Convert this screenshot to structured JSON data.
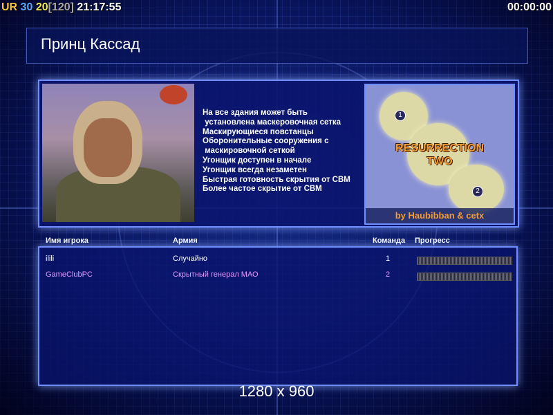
{
  "hud": {
    "ur": "UR",
    "fps": "30",
    "frame": "20",
    "frame_bracket": "[120]",
    "clock": "21:17:55",
    "timer": "00:00:00"
  },
  "title": "Принц Кассад",
  "briefing": {
    "bullets": "На все здания может быть\n установлена маскеровочная сетка\nМаскирующиеся повстанцы\nОборонительные сооружения с\n маскировочной сеткой\nУгонщик доступен в начале\nУгонщик всегда незаметен\nБыстрая готовность скрытия от СВМ\nБолее частое скрытие от СВМ"
  },
  "map": {
    "title": "RESURRECTION\nTWO",
    "credit": "by Haubibban & cetx",
    "start1": "1",
    "start2": "2"
  },
  "table": {
    "headers": {
      "player": "Имя игрока",
      "army": "Армия",
      "team": "Команда",
      "progress": "Прогресс"
    },
    "rows": [
      {
        "player": "ilili",
        "army": "Случайно",
        "team": "1",
        "color": "#ffffff"
      },
      {
        "player": "GameClubPC",
        "army": "Скрытный генерал МАО",
        "team": "2",
        "color": "#e39bff"
      }
    ]
  },
  "resolution": "1280 x 960"
}
